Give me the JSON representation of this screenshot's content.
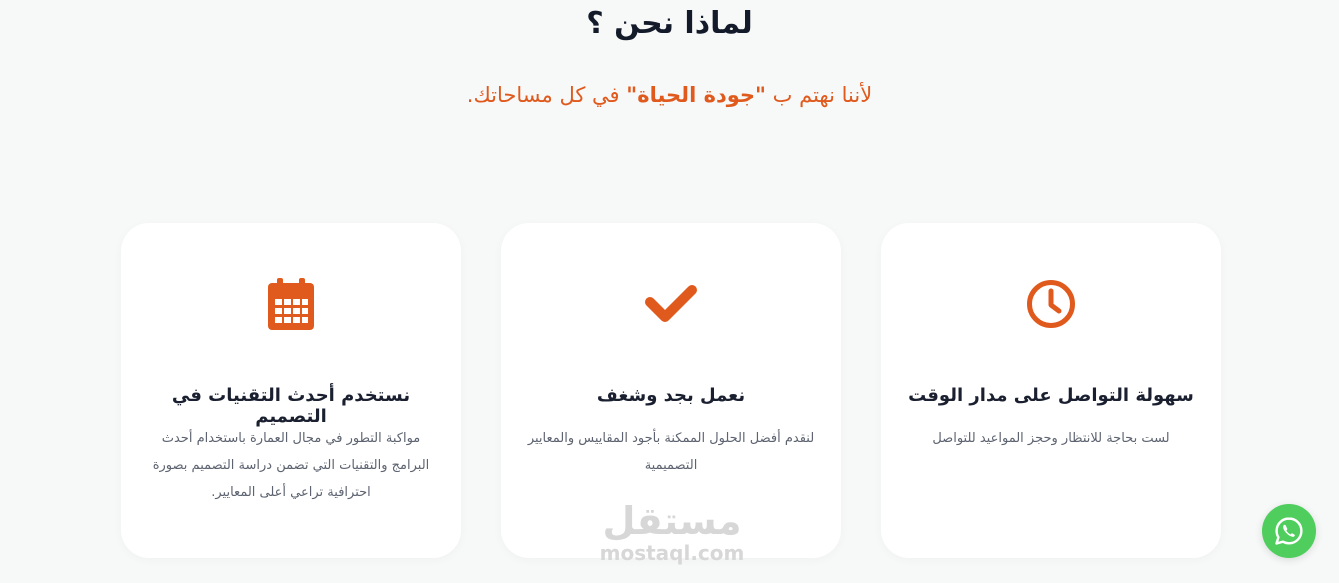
{
  "section": {
    "title": "لماذا نحن ؟",
    "subtitle_before": "لأننا نهتم ب ",
    "subtitle_highlight": "\"جودة الحياة\"",
    "subtitle_after": " في كل مساحاتك."
  },
  "cards": [
    {
      "icon": "calendar-icon",
      "title": "نستخدم أحدث التقنيات في التصميم",
      "text": "مواكبة التطور في مجال العمارة باستخدام أحدث البرامج والتقنيات التي تضمن دراسة التصميم بصورة احترافية تراعي أعلى المعايير."
    },
    {
      "icon": "checkmark-icon",
      "title": "نعمل بجد وشغف",
      "text": "لنقدم أفضل الحلول الممكنة بأجود المقاييس والمعايير التصميمية"
    },
    {
      "icon": "clock-icon",
      "title": "سهولة التواصل على مدار الوقت",
      "text": "لست بحاجة للانتظار وحجز المواعيد للتواصل"
    }
  ],
  "watermark": {
    "arabic": "مستقل",
    "latin": "mostaql.com"
  },
  "whatsapp": {
    "icon": "whatsapp-icon"
  },
  "colors": {
    "accent": "#e05a1e",
    "background": "#f7f8f8",
    "card": "#ffffff",
    "heading": "#131a2a",
    "whatsapp": "#4fce5d"
  }
}
